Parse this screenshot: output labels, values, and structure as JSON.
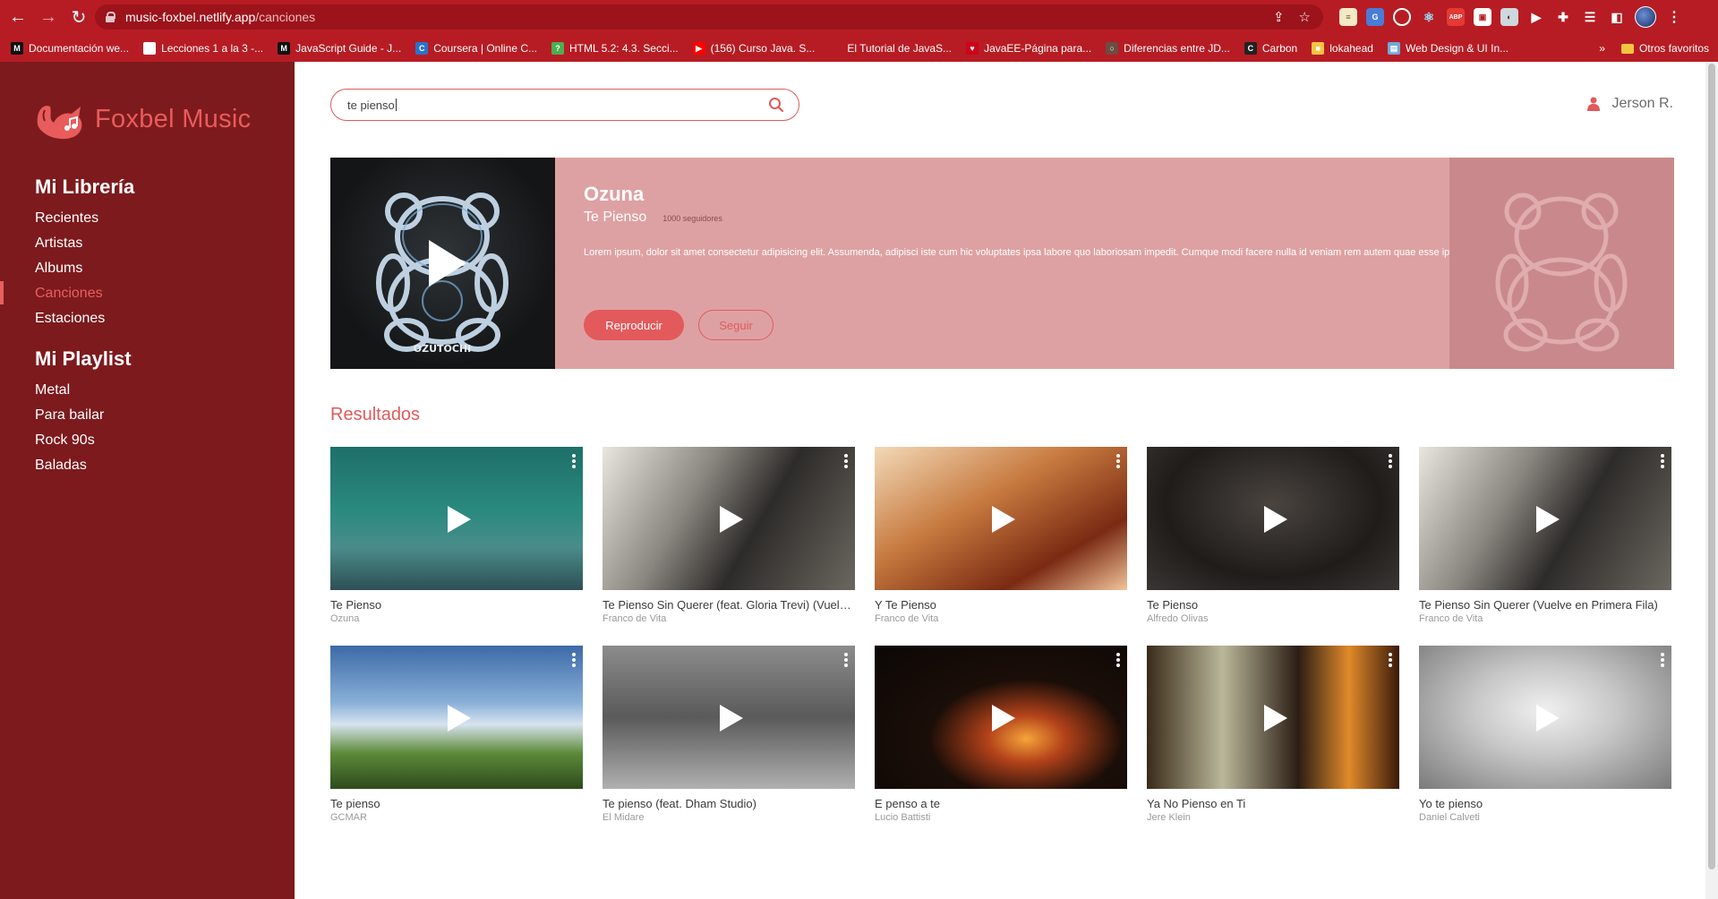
{
  "browser": {
    "url_host": "music-foxbel.netlify.app",
    "url_path": "/canciones",
    "bookmarks": [
      {
        "label": "Documentación we...",
        "icon": "M",
        "color": "#111111"
      },
      {
        "label": "Lecciones 1 a la 3 -...",
        "icon": "▣",
        "color": "#ffffff"
      },
      {
        "label": "JavaScript Guide - J...",
        "icon": "M",
        "color": "#111111"
      },
      {
        "label": "Coursera | Online C...",
        "icon": "C",
        "color": "#2a73cc"
      },
      {
        "label": "HTML 5.2: 4.3. Secci...",
        "icon": "?",
        "color": "#4caf50"
      },
      {
        "label": "(156) Curso Java. S...",
        "icon": "▶",
        "color": "#ff0000"
      },
      {
        "label": "El Tutorial de JavaS...",
        "icon": "",
        "color": "#b71c24"
      },
      {
        "label": "JavaEE-Página para...",
        "icon": "♥",
        "color": "#d0021b"
      },
      {
        "label": "Diferencias entre JD...",
        "icon": "○",
        "color": "#6d4c41"
      },
      {
        "label": "Carbon",
        "icon": "C",
        "color": "#222222"
      },
      {
        "label": "lokahead",
        "icon": "■",
        "color": "#f5c542"
      },
      {
        "label": "Web Design & UI In...",
        "icon": "▤",
        "color": "#6fa8dc"
      }
    ],
    "more_bookmarks": "»",
    "other_favorites": "Otros favoritos"
  },
  "sidebar": {
    "logo_text": "Foxbel Music",
    "library_title": "Mi Librería",
    "library_items": [
      {
        "label": "Recientes",
        "active": false
      },
      {
        "label": "Artistas",
        "active": false
      },
      {
        "label": "Albums",
        "active": false
      },
      {
        "label": "Canciones",
        "active": true
      },
      {
        "label": "Estaciones",
        "active": false
      }
    ],
    "playlist_title": "Mi Playlist",
    "playlist_items": [
      "Metal",
      "Para bailar",
      "Rock 90s",
      "Baladas"
    ]
  },
  "search": {
    "value": "te pienso"
  },
  "user": {
    "name": "Jerson R."
  },
  "hero": {
    "artist": "Ozuna",
    "song": "Te Pienso",
    "followers": "1000 seguidores",
    "description": "Lorem ipsum, dolor sit amet consectetur adipisicing elit. Assumenda, adipisci iste cum hic voluptates ipsa labore quo laboriosam impedit. Cumque modi facere nulla id veniam rem autem quae esse ipsam.",
    "play_label": "Reproducir",
    "follow_label": "Seguir",
    "cover_text": "OZUTOCHI"
  },
  "results": {
    "title": "Resultados",
    "items": [
      {
        "title": "Te Pienso",
        "artist": "Ozuna"
      },
      {
        "title": "Te Pienso Sin Querer (feat. Gloria Trevi) (Vuelve en Primera Fila)",
        "artist": "Franco de Vita"
      },
      {
        "title": "Y Te Pienso",
        "artist": "Franco de Vita"
      },
      {
        "title": "Te Pienso",
        "artist": "Alfredo Olivas"
      },
      {
        "title": "Te Pienso Sin Querer (Vuelve en Primera Fila)",
        "artist": "Franco de Vita"
      },
      {
        "title": "Te pienso",
        "artist": "GCMAR"
      },
      {
        "title": "Te pienso (feat. Dham Studio)",
        "artist": "El Midare"
      },
      {
        "title": "E penso a te",
        "artist": "Lucio Battisti"
      },
      {
        "title": "Ya No Pienso en Ti",
        "artist": "Jere Klein"
      },
      {
        "title": "Yo te pienso",
        "artist": "Daniel Calveti"
      }
    ]
  },
  "colors": {
    "chrome": "#b71c24",
    "sidebar": "#7d1a1d",
    "accent": "#e05a5a",
    "hero_bg": "#dea1a3"
  }
}
